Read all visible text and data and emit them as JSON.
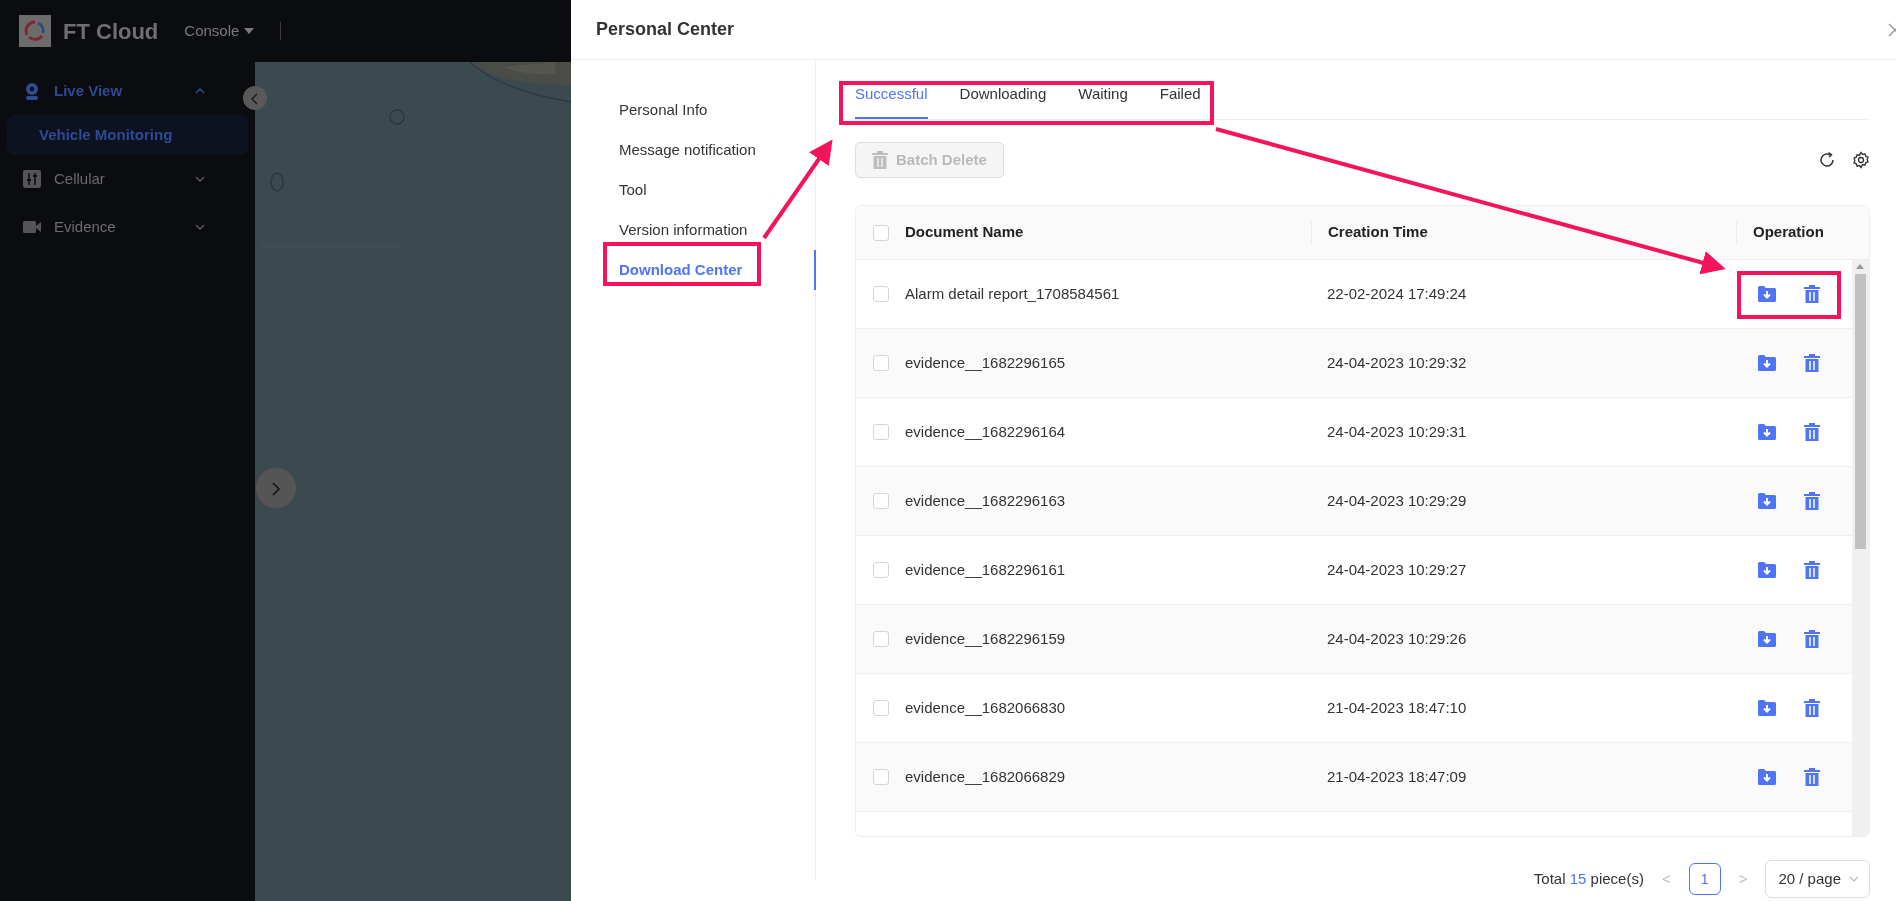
{
  "app": {
    "logo_text": "FT Cloud",
    "menu": "Console"
  },
  "sidebar": {
    "items": [
      {
        "label": "Live View",
        "expanded": true,
        "children": [
          {
            "label": "Vehicle Monitoring",
            "selected": true
          }
        ]
      },
      {
        "label": "Cellular",
        "expanded": false
      },
      {
        "label": "Evidence",
        "expanded": false
      }
    ]
  },
  "drawer": {
    "title": "Personal Center",
    "menu": [
      {
        "label": "Personal Info",
        "selected": false
      },
      {
        "label": "Message notification",
        "selected": false
      },
      {
        "label": "Tool",
        "selected": false
      },
      {
        "label": "Version information",
        "selected": false
      },
      {
        "label": "Download Center",
        "selected": true
      }
    ],
    "tabs": [
      {
        "label": "Successful",
        "selected": true
      },
      {
        "label": "Downloading",
        "selected": false
      },
      {
        "label": "Waiting",
        "selected": false
      },
      {
        "label": "Failed",
        "selected": false
      }
    ],
    "batch_delete": {
      "label": "Batch Delete",
      "disabled": true
    },
    "table": {
      "select_all": {
        "checked": false
      },
      "columns": [
        "Document Name",
        "Creation Time",
        "Operation"
      ],
      "rows": [
        {
          "name": "Alarm detail report_1708584561",
          "time": "22-02-2024 17:49:24",
          "checked": false
        },
        {
          "name": "evidence__1682296165",
          "time": "24-04-2023 10:29:32",
          "checked": false
        },
        {
          "name": "evidence__1682296164",
          "time": "24-04-2023 10:29:31",
          "checked": false
        },
        {
          "name": "evidence__1682296163",
          "time": "24-04-2023 10:29:29",
          "checked": false
        },
        {
          "name": "evidence__1682296161",
          "time": "24-04-2023 10:29:27",
          "checked": false
        },
        {
          "name": "evidence__1682296159",
          "time": "24-04-2023 10:29:26",
          "checked": false
        },
        {
          "name": "evidence__1682066830",
          "time": "21-04-2023 18:47:10",
          "checked": false
        },
        {
          "name": "evidence__1682066829",
          "time": "21-04-2023 18:47:09",
          "checked": false
        }
      ]
    },
    "pagination": {
      "total_prefix": "Total",
      "total": "15",
      "total_suffix": "piece(s)",
      "prev": "<",
      "pages": [
        {
          "label": "1",
          "selected": true
        }
      ],
      "next": ">",
      "page_size": "20 / page"
    }
  }
}
